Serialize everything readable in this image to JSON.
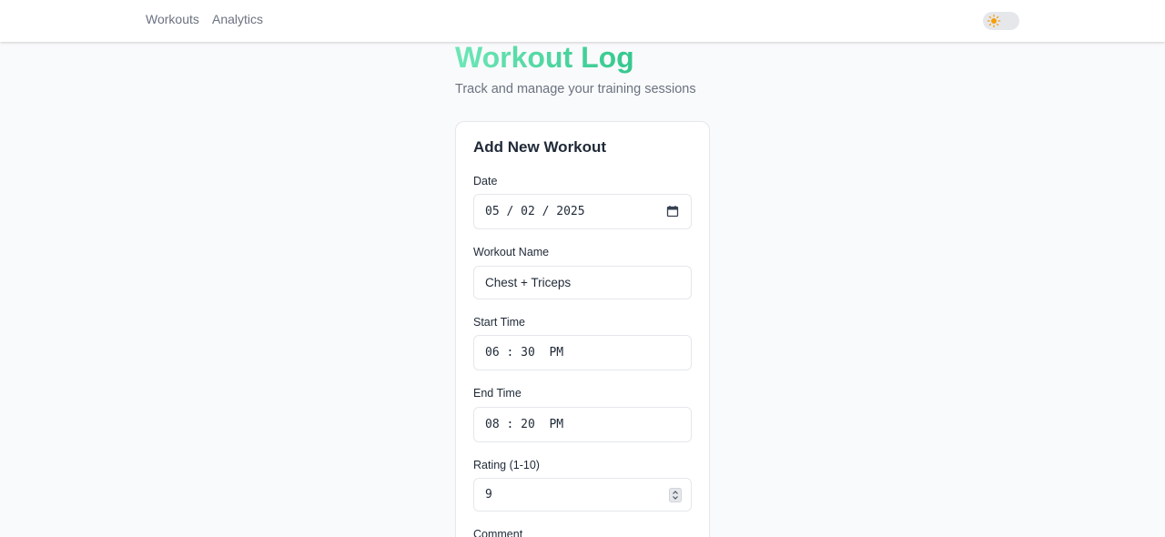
{
  "nav": {
    "workouts": "Workouts",
    "analytics": "Analytics"
  },
  "header": {
    "title": "Workout Log",
    "subtitle": "Track and manage your training sessions"
  },
  "form": {
    "title": "Add New Workout",
    "date": {
      "label": "Date",
      "value": "05 / 02 / 2025"
    },
    "workout_name": {
      "label": "Workout Name",
      "value": "Chest + Triceps"
    },
    "start_time": {
      "label": "Start Time",
      "value": "06 : 30  PM"
    },
    "end_time": {
      "label": "End Time",
      "value": "08 : 20  PM"
    },
    "rating": {
      "label": "Rating (1-10)",
      "value": "9"
    },
    "comment": {
      "label": "Comment"
    }
  },
  "colors": {
    "title_gradient_start": "#6ee7b7",
    "title_gradient_end": "#34c78e",
    "sun": "#f59e0b"
  }
}
